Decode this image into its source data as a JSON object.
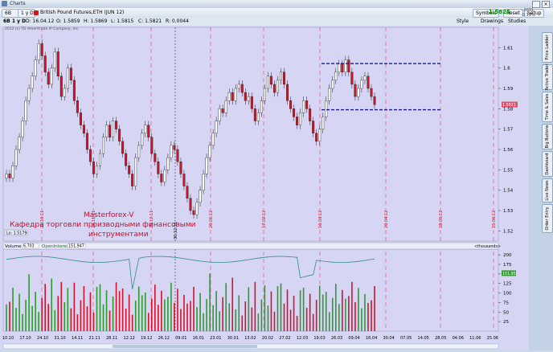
{
  "window": {
    "title": "Charts"
  },
  "toolbar": {
    "symbol": "6B",
    "timeframe": "1 y D",
    "instrument": "British Pound Futures,ETH (JUN 12)",
    "symbols_label": "Symbols",
    "reset_label": "Reset",
    "setup_label": "Setup",
    "last_price": "1.5825",
    "change": "-.0031",
    "change_pct": "-0.19%"
  },
  "stylebar": {
    "legend": "6B 1 y D",
    "date": "D: 16.04.12",
    "open": "O: 1.5859",
    "high": "H: 1.5869",
    "low": "L: 1.5815",
    "close": "C: 1.5821",
    "range": "R: 0.0044",
    "style_label": "Style",
    "drawings_label": "Drawings",
    "studies_label": "Studies"
  },
  "copyright": "2012 (c) TD Ameritrade IP Company, Inc.",
  "price_axis": {
    "labels": [
      "1.61",
      "1.6",
      "1.59",
      "1.58",
      "1.57",
      "1.56",
      "1.55",
      "1.54",
      "1.53",
      "1.52"
    ],
    "highlight": "1.5821"
  },
  "lo_label": "Lo: 1.5179",
  "watermark": {
    "line1": "Masterforex-V",
    "line2": "Кафедра торговли производными финансовыми",
    "line3": "инструментами"
  },
  "red_date_labels": [
    "21.10.11",
    "22.11.11",
    "20.12.11",
    "20.01.12",
    "17.02.12",
    "16.03.12",
    "20.04.12",
    "18.05.12",
    "15.06.12"
  ],
  "black_date_label": "30.12.11",
  "volume_panel": {
    "volume_label": "Volume",
    "volume_value": "6,703",
    "oi_label": "OpenInterest",
    "oi_value": "151,947",
    "units": "<thousands>",
    "oi_badge": "151.95"
  },
  "volume_axis": [
    "200",
    "175",
    "150",
    "125",
    "100",
    "75",
    "50",
    "25"
  ],
  "x_axis": [
    "10.10",
    "17.10",
    "24.10",
    "31.10",
    "14.11",
    "21.11",
    "28.11",
    "12.12",
    "19.12",
    "26.12",
    "09.01",
    "16.01",
    "23.01",
    "30.01",
    "13.02",
    "20.02",
    "27.02",
    "12.03",
    "19.03",
    "26.03",
    "09.04",
    "16.04",
    "30.04",
    "07.05",
    "14.05",
    "28.05",
    "04.06",
    "11.06",
    "25.06"
  ],
  "side_tabs": [
    "Price Ladder",
    "Active Trader",
    "Time & Sales",
    "Big Buttons",
    "Dashboard",
    "Live News",
    "Order Entry"
  ],
  "colors": {
    "up": "#ffffff",
    "down": "#d0142a",
    "resistance": "#1a1a8c",
    "watermark": "#d00a2a",
    "oi_line": "#2e8b8b"
  }
}
